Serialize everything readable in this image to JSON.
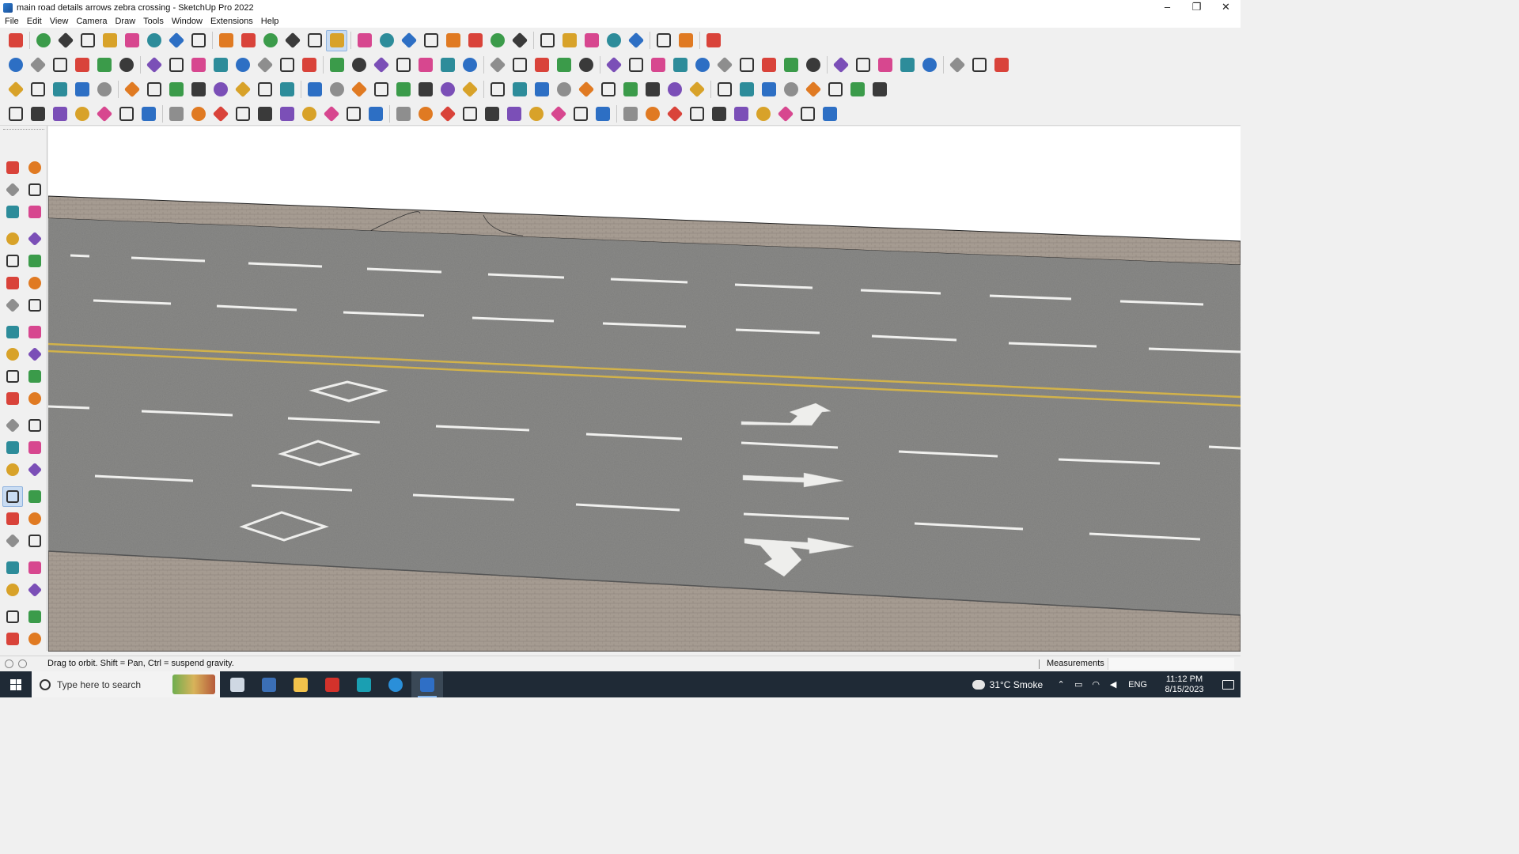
{
  "window": {
    "title": "main road details arrows zebra crossing - SketchUp Pro 2022",
    "controls": {
      "minimize": "–",
      "restore": "❐",
      "close": "✕"
    }
  },
  "menu": [
    "File",
    "Edit",
    "View",
    "Camera",
    "Draw",
    "Tools",
    "Window",
    "Extensions",
    "Help"
  ],
  "toolbars": {
    "row1": [
      "zoom-icon",
      "select-icon",
      "eraser-icon",
      "pencil-icon",
      "freehand-icon",
      "rectangle-icon",
      "pushpull-icon",
      "followme-icon",
      "move-icon",
      "rotate-icon",
      "scale-icon",
      "tape-measure-icon",
      "text-icon",
      "paint-bucket-icon",
      "orbit-icon",
      "pan-icon",
      "zoom-window-icon",
      "zoom-extents-icon",
      "section-plane-icon",
      "display-section-icon",
      "section-fill-icon",
      "x-ray-icon",
      "components-icon",
      "materials-icon",
      "styles-icon",
      "axes-icon",
      "flip-icon",
      "solid-tools-icon",
      "undo-icon",
      "redo-icon",
      "sandbox-icon"
    ],
    "row2": [
      "box-icon",
      "sphere-icon",
      "cylinder-icon",
      "offset-icon",
      "extrude-icon",
      "lathe-icon",
      "sweep-icon",
      "loft-icon",
      "bend-icon",
      "twist-icon",
      "curve-icon",
      "split-icon",
      "slice-icon",
      "intersect-icon",
      "roof-icon",
      "wall-icon",
      "house-icon",
      "door-icon",
      "window-icon",
      "stairs-icon",
      "terrain-icon",
      "grass-icon",
      "tree-icon",
      "path-icon",
      "fence-icon",
      "rail-icon",
      "arc-icon",
      "circle-icon",
      "polygon-icon",
      "ellipse-icon",
      "parallelogram-icon",
      "spline-icon",
      "helix-icon",
      "weld-icon",
      "loop-icon",
      "measure-icon",
      "highlight-icon",
      "texture-icon",
      "brick-icon",
      "shingle-icon",
      "panel-icon",
      "stone-icon",
      "mesh-icon",
      "roof-tile-icon"
    ],
    "row3": [
      "layer-icon",
      "tag-icon",
      "folder-icon",
      "sketch-icon",
      "label-icon",
      "tape-icon",
      "rotate-flip-icon",
      "rect-red-icon",
      "grid-icon",
      "note-icon",
      "fold-icon",
      "chain-icon",
      "hook-icon",
      "dots-line-icon",
      "cross-icon",
      "plus-green-icon",
      "crosshair-icon",
      "cone-icon",
      "pin-icon",
      "triangle-icon",
      "coil-icon",
      "scissors-icon",
      "spiral-icon",
      "star-icon",
      "bucket-icon",
      "magnet-icon",
      "boxes-icon",
      "stack-icon",
      "stack2-icon",
      "stack3-icon",
      "cube-red-icon",
      "gear-icon",
      "frame-icon",
      "tile-icon",
      "tile2-icon",
      "tile3-icon",
      "close-x-icon",
      "curve-dots-icon",
      "qr-icon"
    ],
    "row4": [
      "nodes-icon",
      "spline-red-icon",
      "car-icon",
      "lasso-icon",
      "box-outline-icon",
      "rope-icon",
      "layers-outline-icon",
      "shell-icon",
      "cut-icon",
      "angle-icon",
      "corner-icon",
      "line-red-icon",
      "knife-icon",
      "fence-outline-icon",
      "skew-icon",
      "column-icon",
      "hand-icon",
      "rails-icon",
      "arrow-left-icon",
      "stack-lines-icon",
      "slant-icon",
      "wing-icon",
      "wing2-icon",
      "wing3-icon",
      "stairs-outline-icon",
      "hatch-icon",
      "archway-icon",
      "pillar-icon",
      "panel-lines-icon",
      "diag-hatch-icon",
      "comb-icon",
      "ribs-icon",
      "sphere-outline-icon",
      "fan-icon",
      "wave-icon",
      "fan2-icon",
      "skin-icon"
    ]
  },
  "left_toolbar": [
    "select-arrow-icon",
    "orbit-icon",
    "paint-bucket-icon",
    "eraser-icon",
    "component-icon",
    "tape-icon",
    "pencil-icon",
    "freehand-icon",
    "rectangle-icon",
    "rotated-rect-icon",
    "circle-icon",
    "polygon-icon",
    "arc-icon",
    "pie-icon",
    "arc2-icon",
    "arc3-icon",
    "move-icon",
    "pushpull-icon",
    "rotate-icon",
    "followme-icon",
    "scale-icon",
    "offset-icon",
    "tape-measure-icon",
    "dimension-icon",
    "protractor-icon",
    "text-icon",
    "axes-icon",
    "3d-text-icon",
    "orbit-active-icon",
    "pan-hand-icon",
    "zoom-icon",
    "zoom-window-icon",
    "zoom-extents-icon",
    "previous-icon",
    "walk-icon",
    "look-around-icon",
    "footprints-icon",
    "position-camera-icon",
    "section-icon",
    "display-sections-icon",
    "section-cuts-icon",
    "section-fill-icon"
  ],
  "status": {
    "hint": "Drag to orbit. Shift = Pan, Ctrl = suspend gravity.",
    "measurements_label": "Measurements",
    "measurements_value": ""
  },
  "taskbar": {
    "search_placeholder": "Type here to search",
    "apps": [
      "task-view-icon",
      "calculator-icon",
      "file-explorer-icon",
      "acrobat-icon",
      "3dsmax-icon",
      "edge-icon",
      "sketchup-icon"
    ],
    "weather": "31°C  Smoke",
    "lang": "ENG",
    "time": "11:12 PM",
    "date": "8/15/2023"
  },
  "colors": {
    "asphalt": "#8a8a88",
    "sidewalk": "#a59b91",
    "yellow_line": "#d2b24a",
    "lane_marking": "#f0f0ee",
    "active_tool": "#c9dcf2"
  }
}
